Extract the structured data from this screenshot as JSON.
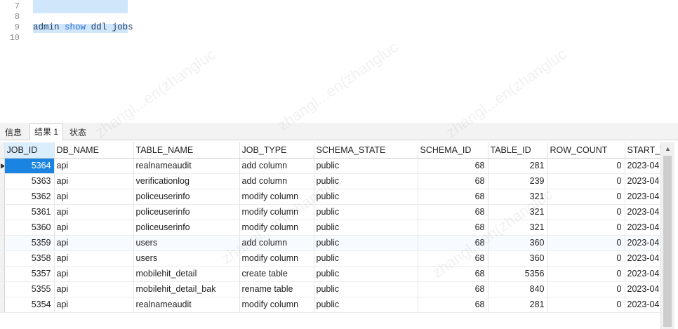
{
  "editor": {
    "line_numbers": [
      "7",
      "8",
      "9",
      "10"
    ],
    "code": {
      "word1": "admin",
      "word2": "show",
      "word3": "ddl",
      "word4": "jobs"
    }
  },
  "tabs": [
    {
      "label": "信息"
    },
    {
      "label": "结果 1"
    },
    {
      "label": "状态"
    }
  ],
  "grid": {
    "columns": [
      "JOB_ID",
      "DB_NAME",
      "TABLE_NAME",
      "JOB_TYPE",
      "SCHEMA_STATE",
      "SCHEMA_ID",
      "TABLE_ID",
      "ROW_COUNT",
      "START_T"
    ],
    "rows": [
      [
        "5364",
        "api",
        "realnameaudit",
        "add column",
        "public",
        "68",
        "281",
        "0",
        "2023-04"
      ],
      [
        "5363",
        "api",
        "verificationlog",
        "add column",
        "public",
        "68",
        "239",
        "0",
        "2023-04"
      ],
      [
        "5362",
        "api",
        "policeuserinfo",
        "modify column",
        "public",
        "68",
        "321",
        "0",
        "2023-04"
      ],
      [
        "5361",
        "api",
        "policeuserinfo",
        "modify column",
        "public",
        "68",
        "321",
        "0",
        "2023-04"
      ],
      [
        "5360",
        "api",
        "policeuserinfo",
        "modify column",
        "public",
        "68",
        "321",
        "0",
        "2023-04"
      ],
      [
        "5359",
        "api",
        "users",
        "add column",
        "public",
        "68",
        "360",
        "0",
        "2023-04"
      ],
      [
        "5358",
        "api",
        "users",
        "modify column",
        "public",
        "68",
        "360",
        "0",
        "2023-04"
      ],
      [
        "5357",
        "api",
        "mobilehit_detail",
        "create table",
        "public",
        "68",
        "5356",
        "0",
        "2023-04"
      ],
      [
        "5355",
        "api",
        "mobilehit_detail_bak",
        "rename table",
        "public",
        "68",
        "840",
        "0",
        "2023-04"
      ],
      [
        "5354",
        "api",
        "realnameaudit",
        "modify column",
        "public",
        "68",
        "281",
        "0",
        "2023-04"
      ]
    ]
  }
}
